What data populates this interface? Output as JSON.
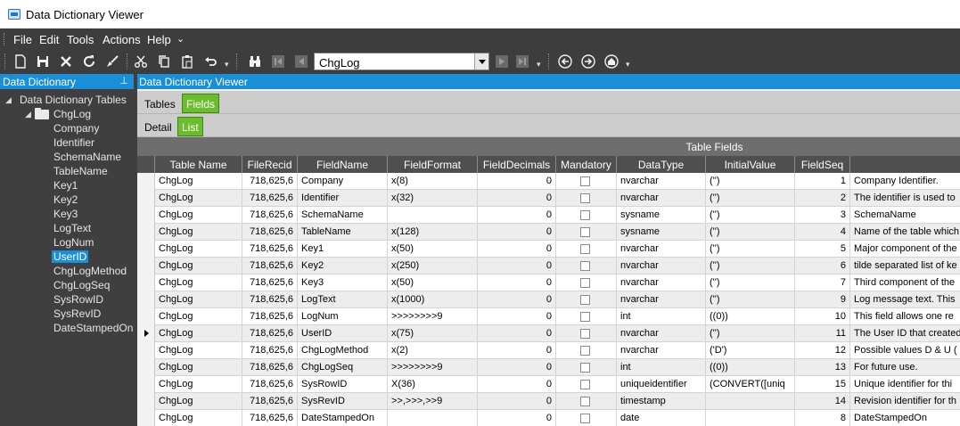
{
  "window": {
    "title": "Data Dictionary Viewer"
  },
  "menu": {
    "items": [
      "File",
      "Edit",
      "Tools",
      "Actions",
      "Help"
    ]
  },
  "toolbar": {
    "combo_value": "ChgLog",
    "icons": [
      "new-icon",
      "save-icon",
      "delete-icon",
      "refresh-icon",
      "clear-icon",
      "cut-icon",
      "copy-icon",
      "paste-icon",
      "undo-icon",
      "binoculars-icon",
      "first-record-icon",
      "previous-record-icon",
      "next-record-icon",
      "last-record-icon",
      "back-icon",
      "forward-icon",
      "home-icon"
    ]
  },
  "left_panel": {
    "title": "Data Dictionary",
    "root": "Data Dictionary Tables",
    "table": "ChgLog",
    "fields": [
      "Company",
      "Identifier",
      "SchemaName",
      "TableName",
      "Key1",
      "Key2",
      "Key3",
      "LogText",
      "LogNum",
      "UserID",
      "ChgLogMethod",
      "ChgLogSeq",
      "SysRowID",
      "SysRevID",
      "DateStampedOn"
    ],
    "selected": "UserID"
  },
  "right_panel": {
    "title": "Data Dictionary Viewer",
    "tabs1": [
      "Tables",
      "Fields"
    ],
    "tabs1_active": "Fields",
    "tabs2": [
      "Detail",
      "List"
    ],
    "tabs2_active": "List",
    "grid_caption": "Table Fields",
    "columns": [
      "Table Name",
      "FileRecid",
      "FieldName",
      "FieldFormat",
      "FieldDecimals",
      "Mandatory",
      "DataType",
      "InitialValue",
      "FieldSeq",
      ""
    ],
    "rows": [
      {
        "table": "ChgLog",
        "recid": "718,625,6",
        "field": "Company",
        "format": "x(8)",
        "decimals": "0",
        "mandatory": false,
        "datatype": "nvarchar",
        "initial": "('')",
        "seq": "1",
        "desc": "Company Identifier."
      },
      {
        "table": "ChgLog",
        "recid": "718,625,6",
        "field": "Identifier",
        "format": "x(32)",
        "decimals": "0",
        "mandatory": false,
        "datatype": "nvarchar",
        "initial": "('')",
        "seq": "2",
        "desc": "The identifier is used to"
      },
      {
        "table": "ChgLog",
        "recid": "718,625,6",
        "field": "SchemaName",
        "format": "",
        "decimals": "0",
        "mandatory": false,
        "datatype": "sysname",
        "initial": "('')",
        "seq": "3",
        "desc": "SchemaName"
      },
      {
        "table": "ChgLog",
        "recid": "718,625,6",
        "field": "TableName",
        "format": "x(128)",
        "decimals": "0",
        "mandatory": false,
        "datatype": "sysname",
        "initial": "('')",
        "seq": "4",
        "desc": "Name of the table which"
      },
      {
        "table": "ChgLog",
        "recid": "718,625,6",
        "field": "Key1",
        "format": "x(50)",
        "decimals": "0",
        "mandatory": false,
        "datatype": "nvarchar",
        "initial": "('')",
        "seq": "5",
        "desc": "Major component of the"
      },
      {
        "table": "ChgLog",
        "recid": "718,625,6",
        "field": "Key2",
        "format": "x(250)",
        "decimals": "0",
        "mandatory": false,
        "datatype": "nvarchar",
        "initial": "('')",
        "seq": "6",
        "desc": "tilde separated list of ke"
      },
      {
        "table": "ChgLog",
        "recid": "718,625,6",
        "field": "Key3",
        "format": "x(50)",
        "decimals": "0",
        "mandatory": false,
        "datatype": "nvarchar",
        "initial": "('')",
        "seq": "7",
        "desc": "Third component of the"
      },
      {
        "table": "ChgLog",
        "recid": "718,625,6",
        "field": "LogText",
        "format": "x(1000)",
        "decimals": "0",
        "mandatory": false,
        "datatype": "nvarchar",
        "initial": "('')",
        "seq": "9",
        "desc": "Log message text.  This"
      },
      {
        "table": "ChgLog",
        "recid": "718,625,6",
        "field": "LogNum",
        "format": ">>>>>>>>9",
        "decimals": "0",
        "mandatory": false,
        "datatype": "int",
        "initial": "((0))",
        "seq": "10",
        "desc": "This field allows one re"
      },
      {
        "table": "ChgLog",
        "recid": "718,625,6",
        "field": "UserID",
        "format": "x(75)",
        "decimals": "0",
        "mandatory": false,
        "datatype": "nvarchar",
        "initial": "('')",
        "seq": "11",
        "desc": "The User ID that created"
      },
      {
        "table": "ChgLog",
        "recid": "718,625,6",
        "field": "ChgLogMethod",
        "format": "x(2)",
        "decimals": "0",
        "mandatory": false,
        "datatype": "nvarchar",
        "initial": "('D')",
        "seq": "12",
        "desc": "Possible values D & U ("
      },
      {
        "table": "ChgLog",
        "recid": "718,625,6",
        "field": "ChgLogSeq",
        "format": ">>>>>>>>9",
        "decimals": "0",
        "mandatory": false,
        "datatype": "int",
        "initial": "((0))",
        "seq": "13",
        "desc": "For future use."
      },
      {
        "table": "ChgLog",
        "recid": "718,625,6",
        "field": "SysRowID",
        "format": "X(36)",
        "decimals": "0",
        "mandatory": false,
        "datatype": "uniqueidentifier",
        "initial": "(CONVERT([uniq",
        "seq": "15",
        "desc": "Unique identifier for thi"
      },
      {
        "table": "ChgLog",
        "recid": "718,625,6",
        "field": "SysRevID",
        "format": ">>,>>>,>>9",
        "decimals": "0",
        "mandatory": false,
        "datatype": "timestamp",
        "initial": "",
        "seq": "14",
        "desc": "Revision identifier for th"
      },
      {
        "table": "ChgLog",
        "recid": "718,625,6",
        "field": "DateStampedOn",
        "format": "",
        "decimals": "0",
        "mandatory": false,
        "datatype": "date",
        "initial": "",
        "seq": "8",
        "desc": "DateStampedOn"
      }
    ],
    "current_row_index": 9
  },
  "colors": {
    "accent": "#1a8fd8",
    "tab_active": "#6cbd2e",
    "chrome": "#3d3d3d"
  }
}
